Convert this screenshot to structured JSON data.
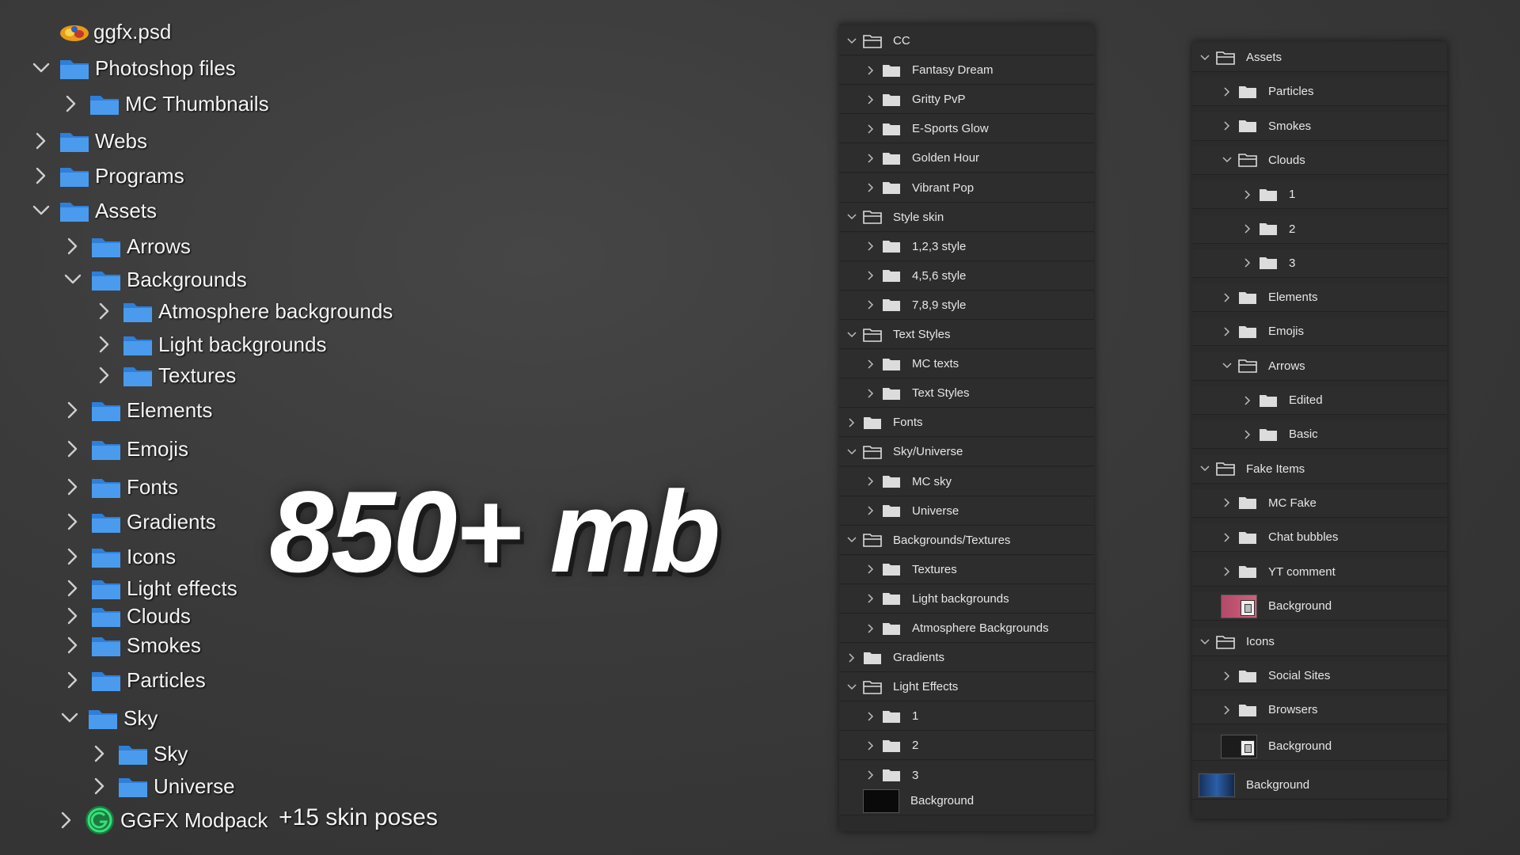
{
  "tree": {
    "root_file": "ggfx.psd",
    "items": [
      {
        "label": "Photoshop files",
        "expanded": true
      },
      {
        "label": "MC Thumbnails",
        "expanded": false
      },
      {
        "label": "Webs",
        "expanded": false
      },
      {
        "label": "Programs",
        "expanded": false
      },
      {
        "label": "Assets",
        "expanded": true
      },
      {
        "label": "Arrows",
        "expanded": false
      },
      {
        "label": "Backgrounds",
        "expanded": true
      },
      {
        "label": "Atmosphere backgrounds",
        "expanded": false
      },
      {
        "label": "Light backgrounds",
        "expanded": false
      },
      {
        "label": "Textures",
        "expanded": false
      },
      {
        "label": "Elements",
        "expanded": false
      },
      {
        "label": "Emojis",
        "expanded": false
      },
      {
        "label": "Fonts",
        "expanded": false
      },
      {
        "label": "Gradients",
        "expanded": false
      },
      {
        "label": "Icons",
        "expanded": false
      },
      {
        "label": "Light effects",
        "expanded": false
      },
      {
        "label": "Clouds",
        "expanded": false
      },
      {
        "label": "Smokes",
        "expanded": false
      },
      {
        "label": "Particles",
        "expanded": false
      },
      {
        "label": "Sky",
        "expanded": true
      },
      {
        "label": "Sky",
        "expanded": false
      },
      {
        "label": "Universe",
        "expanded": false
      },
      {
        "label": "GGFX Modpack",
        "expanded": false
      }
    ],
    "extra_note": "+15 skin poses"
  },
  "headline": "850+ mb",
  "panel1": {
    "layers": [
      {
        "label": "CC",
        "kind": "group",
        "open": true
      },
      {
        "label": "Fantasy Dream",
        "kind": "group",
        "open": false
      },
      {
        "label": "Gritty PvP",
        "kind": "group",
        "open": false
      },
      {
        "label": "E-Sports Glow",
        "kind": "group",
        "open": false
      },
      {
        "label": "Golden Hour",
        "kind": "group",
        "open": false
      },
      {
        "label": "Vibrant Pop",
        "kind": "group",
        "open": false
      },
      {
        "label": "Style skin",
        "kind": "group",
        "open": true
      },
      {
        "label": "1,2,3 style",
        "kind": "group",
        "open": false
      },
      {
        "label": "4,5,6 style",
        "kind": "group",
        "open": false
      },
      {
        "label": "7,8,9 style",
        "kind": "group",
        "open": false
      },
      {
        "label": "Text Styles",
        "kind": "group",
        "open": true
      },
      {
        "label": "MC texts",
        "kind": "group",
        "open": false
      },
      {
        "label": "Text Styles",
        "kind": "group",
        "open": false
      },
      {
        "label": "Fonts",
        "kind": "group",
        "open": false
      },
      {
        "label": "Sky/Universe",
        "kind": "group",
        "open": true
      },
      {
        "label": "MC sky",
        "kind": "group",
        "open": false
      },
      {
        "label": "Universe",
        "kind": "group",
        "open": false
      },
      {
        "label": "Backgrounds/Textures",
        "kind": "group",
        "open": true
      },
      {
        "label": "Textures",
        "kind": "group",
        "open": false
      },
      {
        "label": "Light backgrounds",
        "kind": "group",
        "open": false
      },
      {
        "label": "Atmosphere Backgrounds",
        "kind": "group",
        "open": false
      },
      {
        "label": "Gradients",
        "kind": "group",
        "open": false
      },
      {
        "label": "Light Effects",
        "kind": "group",
        "open": true
      },
      {
        "label": "1",
        "kind": "group",
        "open": false
      },
      {
        "label": "2",
        "kind": "group",
        "open": false
      },
      {
        "label": "3",
        "kind": "group",
        "open": false
      },
      {
        "label": "Background",
        "kind": "layer",
        "thumb": "black"
      }
    ]
  },
  "panel2": {
    "layers": [
      {
        "label": "Assets",
        "kind": "group",
        "open": true
      },
      {
        "label": "Particles",
        "kind": "group",
        "open": false
      },
      {
        "label": "Smokes",
        "kind": "group",
        "open": false
      },
      {
        "label": "Clouds",
        "kind": "group",
        "open": true
      },
      {
        "label": "1",
        "kind": "group",
        "open": false
      },
      {
        "label": "2",
        "kind": "group",
        "open": false
      },
      {
        "label": "3",
        "kind": "group",
        "open": false
      },
      {
        "label": "Elements",
        "kind": "group",
        "open": false
      },
      {
        "label": "Emojis",
        "kind": "group",
        "open": false
      },
      {
        "label": "Arrows",
        "kind": "group",
        "open": true
      },
      {
        "label": "Edited",
        "kind": "group",
        "open": false
      },
      {
        "label": "Basic",
        "kind": "group",
        "open": false
      },
      {
        "label": "Fake Items",
        "kind": "group",
        "open": true
      },
      {
        "label": "MC Fake",
        "kind": "group",
        "open": false
      },
      {
        "label": "Chat bubbles",
        "kind": "group",
        "open": false
      },
      {
        "label": "YT comment",
        "kind": "group",
        "open": false
      },
      {
        "label": "Background",
        "kind": "layer",
        "thumb": "pink"
      },
      {
        "label": "Icons",
        "kind": "group",
        "open": true
      },
      {
        "label": "Social Sites",
        "kind": "group",
        "open": false
      },
      {
        "label": "Browsers",
        "kind": "group",
        "open": false
      },
      {
        "label": "Background",
        "kind": "layer",
        "thumb": "dark"
      },
      {
        "label": "Background",
        "kind": "layer",
        "thumb": "blue"
      }
    ]
  },
  "colors": {
    "folder_blue": "#2f7fd8",
    "folder_blue_light": "#4a9bee",
    "panel_bg": "#2b2b2b"
  }
}
